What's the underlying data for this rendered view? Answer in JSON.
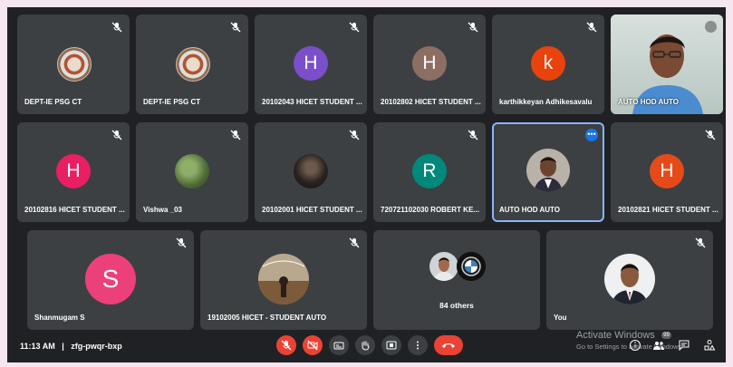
{
  "meeting": {
    "time": "11:13 AM",
    "separator": "|",
    "code": "zfg-pwqr-bxp"
  },
  "tiles": {
    "t1": {
      "name": "DEPT-IE PSG CT"
    },
    "t2": {
      "name": "DEPT-IE PSG CT"
    },
    "t3": {
      "name": "20102043 HICET STUDENT ...",
      "initial": "H",
      "color": "#7b4fc9"
    },
    "t4": {
      "name": "20102802 HICET STUDENT ...",
      "initial": "H",
      "color": "#8d6e63"
    },
    "t5": {
      "name": "karthikkeyan Adhikesavalu",
      "initial": "k",
      "color": "#e8430c"
    },
    "t6": {
      "name": "AUTO HOD AUTO"
    },
    "t7": {
      "name": "20102816 HICET STUDENT ...",
      "initial": "H",
      "color": "#e91e63"
    },
    "t8": {
      "name": "Vishwa _03"
    },
    "t9": {
      "name": "20102001 HICET STUDENT ..."
    },
    "t10": {
      "name": "720721102030 ROBERT KE...",
      "initial": "R",
      "color": "#00897b"
    },
    "t11": {
      "name": "AUTO HOD AUTO",
      "more": "•••"
    },
    "t12": {
      "name": "20102821 HICET STUDENT ...",
      "initial": "H",
      "color": "#e64a19"
    },
    "t13": {
      "name": "Shanmugam S",
      "initial": "S",
      "color": "#ec407a"
    },
    "t14": {
      "name": "19102005 HICET - STUDENT AUTO"
    },
    "t15": {
      "others": "84 others"
    },
    "t16": {
      "name": "You"
    }
  },
  "watermark": {
    "line1": "Activate Windows",
    "line2": "Go to Settings to activate Windows."
  },
  "people_count": "99",
  "icons": [
    "mic-off-icon",
    "camera-off-icon",
    "captions-icon",
    "raise-hand-icon",
    "present-icon",
    "more-options-icon",
    "hang-up-icon",
    "info-icon",
    "people-icon",
    "chat-icon",
    "activities-icon"
  ],
  "colors": {
    "background": "#202124",
    "tile": "#3c4043",
    "danger": "#ea4335",
    "accent": "#8ab4f8"
  }
}
